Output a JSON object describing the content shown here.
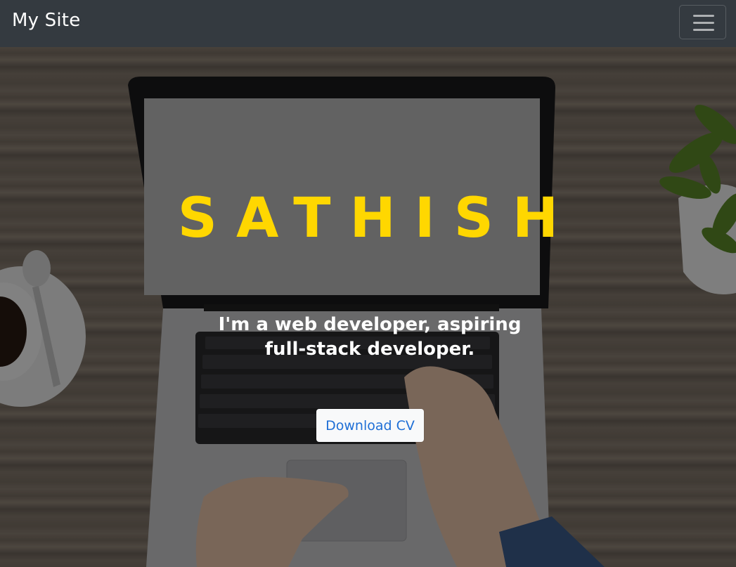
{
  "navbar": {
    "brand": "My Site",
    "toggler_icon": "hamburger-menu-icon"
  },
  "hero": {
    "title": "SATHISH",
    "subtitle": "I'm a web developer, aspiring full-stack developer.",
    "cta_label": "Download CV"
  },
  "colors": {
    "navbar_bg": "#343a40",
    "title": "#ffd700",
    "button_bg": "#f8f9fa",
    "button_text": "#1f6fd6"
  }
}
